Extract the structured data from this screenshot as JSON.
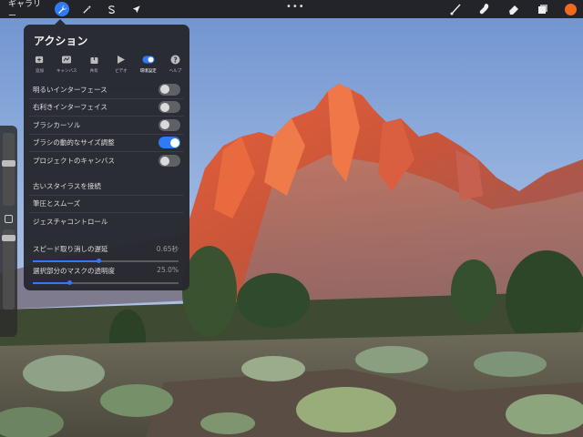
{
  "toolbar": {
    "gallery_label": "ギャラリー",
    "left_tools": [
      {
        "name": "actions",
        "icon": "wrench-icon",
        "active": true
      },
      {
        "name": "adjustments",
        "icon": "magic-wand-icon",
        "active": false
      },
      {
        "name": "selection",
        "icon": "selection-s-icon",
        "active": false
      },
      {
        "name": "transform",
        "icon": "arrow-cursor-icon",
        "active": false
      }
    ],
    "more_label": "•••",
    "right_tools": [
      "brush-icon",
      "smudge-icon",
      "eraser-icon",
      "layers-icon"
    ],
    "current_color": "#f06a1e"
  },
  "actions_panel": {
    "title": "アクション",
    "tabs": [
      {
        "label": "追加",
        "icon": "add-icon"
      },
      {
        "label": "キャンバス",
        "icon": "canvas-icon"
      },
      {
        "label": "共有",
        "icon": "share-icon"
      },
      {
        "label": "ビデオ",
        "icon": "video-play-icon"
      },
      {
        "label": "環境設定",
        "icon": "preferences-toggle-icon",
        "active": true
      },
      {
        "label": "ヘルプ",
        "icon": "help-icon"
      }
    ],
    "toggles": [
      {
        "label": "明るいインターフェース",
        "on": false
      },
      {
        "label": "右利きインターフェイス",
        "on": false
      },
      {
        "label": "ブラシカーソル",
        "on": false
      },
      {
        "label": "ブラシの動的なサイズ調整",
        "on": true
      },
      {
        "label": "プロジェクトのキャンバス",
        "on": false
      }
    ],
    "links": [
      {
        "label": "古いスタイラスを接続"
      },
      {
        "label": "筆圧とスムーズ"
      },
      {
        "label": "ジェスチャコントロール"
      }
    ],
    "sliders": [
      {
        "label": "スピード取り消しの遅延",
        "value": "0.65秒",
        "fraction": 0.45
      },
      {
        "label": "選択部分のマスクの透明度",
        "value": "25.0%",
        "fraction": 0.25
      }
    ]
  },
  "sidebar": {
    "brush_size_level": 0.85,
    "opacity_level": 0.7
  },
  "colors": {
    "accent": "#2f7bf6",
    "panel": "#26282e"
  }
}
